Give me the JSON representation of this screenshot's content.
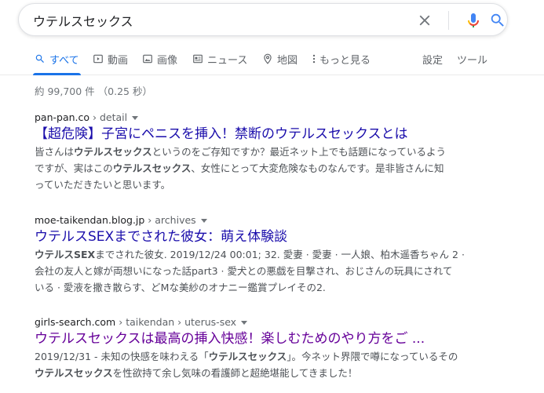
{
  "search": {
    "query": "ウテルスセックス"
  },
  "tabs": [
    {
      "label": "すべて",
      "icon": "search-icon",
      "active": true
    },
    {
      "label": "動画",
      "icon": "video-icon",
      "active": false
    },
    {
      "label": "画像",
      "icon": "image-icon",
      "active": false
    },
    {
      "label": "ニュース",
      "icon": "news-icon",
      "active": false
    },
    {
      "label": "地図",
      "icon": "map-pin-icon",
      "active": false
    },
    {
      "label": "もっと見る",
      "icon": "more-vert-icon",
      "active": false
    }
  ],
  "tools": {
    "settings_label": "設定",
    "tools_label": "ツール"
  },
  "stats": {
    "text": "約 99,700 件 （0.25 秒）"
  },
  "results": [
    {
      "domain": "pan-pan.co",
      "path": " › detail",
      "title": "【超危険】子宮にペニスを挿入！禁断のウテルスセックスとは",
      "visited": false,
      "snippet": [
        [
          {
            "t": "皆さんは",
            "b": false
          },
          {
            "t": "ウテルスセックス",
            "b": true
          },
          {
            "t": "というのをご存知ですか？最近ネット上でも話題になっているよう",
            "b": false
          }
        ],
        [
          {
            "t": "ですが、実はこの",
            "b": false
          },
          {
            "t": "ウテルスセックス",
            "b": true
          },
          {
            "t": "、女性にとって大変危険なものなんです。是非皆さんに知",
            "b": false
          }
        ],
        [
          {
            "t": "っていただきたいと思います。",
            "b": false
          }
        ]
      ]
    },
    {
      "domain": "moe-taikendan.blog.jp",
      "path": " › archives",
      "title": "ウテルスSEXまでされた彼女：萌え体験談",
      "visited": false,
      "snippet": [
        [
          {
            "t": "ウテルスSEX",
            "b": true
          },
          {
            "t": "までされた彼女. 2019/12/24 00:01; 32. 愛妻 · 愛妻 · 一人娘、柏木遥香ちゃん 2 ·",
            "b": false
          }
        ],
        [
          {
            "t": "会社の友人と嫁が両想いになった話part3 · 愛犬との悪戯を目撃され、おじさんの玩具にされて",
            "b": false
          }
        ],
        [
          {
            "t": "いる · 愛液を撒き散らす、どMな美紗のオナニー鑑賞プレイその2.",
            "b": false
          }
        ]
      ]
    },
    {
      "domain": "girls-search.com",
      "path": " › taikendan › uterus-sex",
      "title": "ウテルスセックスは最高の挿入快感！楽しむためのやり方をご ...",
      "visited": true,
      "snippet": [
        [
          {
            "t": "2019/12/31 - 未知の快感を味わえる「",
            "b": false
          },
          {
            "t": "ウテルスセックス",
            "b": true
          },
          {
            "t": "」。今ネット界隈で噂になっているその",
            "b": false
          }
        ],
        [
          {
            "t": "ウテルスセックス",
            "b": true
          },
          {
            "t": "を性欲持て余し気味の看護師と超絶堪能してきました！",
            "b": false
          }
        ]
      ]
    }
  ],
  "colors": {
    "link": "#1a0dab",
    "visited": "#660099",
    "accent": "#1a73e8",
    "snippet": "#4d5156"
  }
}
